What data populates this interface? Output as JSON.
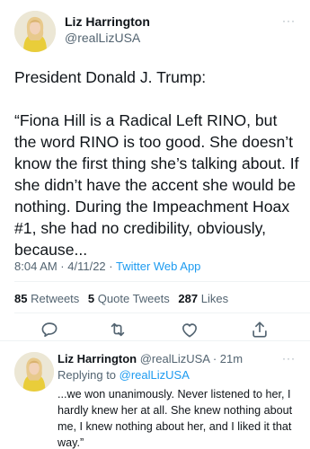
{
  "tweet": {
    "author": {
      "name": "Liz Harrington",
      "handle": "@realLizUSA"
    },
    "text": "President Donald J. Trump:\n\n“Fiona Hill is a Radical Left RINO, but the word RINO is too good. She doesn’t know the first thing she’s talking about. If she didn’t have the accent she would be nothing. During the Impeachment Hoax #1, she had no credibility, obviously, because...",
    "time": "8:04 AM · 4/11/22 · ",
    "source": "Twitter Web App",
    "stats": {
      "retweets": "85",
      "retweets_label": "Retweets",
      "quotes": "5",
      "quotes_label": "Quote Tweets",
      "likes": "287",
      "likes_label": "Likes"
    },
    "more_icon": "···"
  },
  "reply": {
    "name": "Liz Harrington",
    "handle": "@realLizUSA",
    "age": " · 21m",
    "replying_to_label": "Replying to ",
    "replying_to_handle": "@realLizUSA",
    "text": "...we won unanimously. Never listened to her, I hardly knew her at all. She knew nothing about me, I knew nothing about her, and I liked it that way.”",
    "more_icon": "···"
  },
  "icons": {
    "reply": "reply-icon",
    "retweet": "retweet-icon",
    "like": "heart-icon",
    "share": "share-icon"
  },
  "colors": {
    "text": "#0f1419",
    "secondary": "#536471",
    "accent": "#1d9bf0",
    "divider": "#eff3f4"
  }
}
